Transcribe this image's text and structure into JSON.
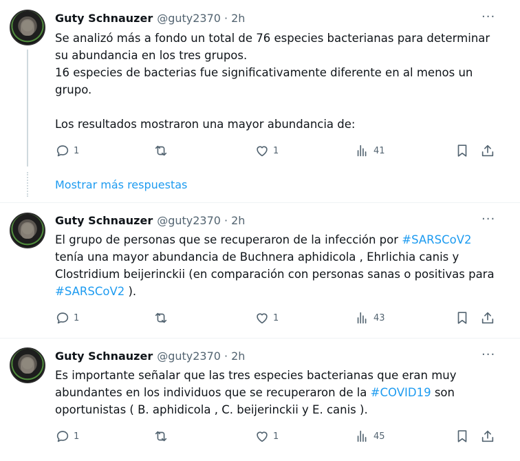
{
  "tweets": [
    {
      "author": "Guty Schnauzer",
      "handle": "@guty2370",
      "separator": "·",
      "time": "2h",
      "more": "···",
      "lines": [
        "Se analizó más a fondo un total de 76 especies bacterianas para determinar",
        "su abundancia en los tres grupos.",
        "16 especies de bacterias fue significativamente diferente en al menos un",
        "grupo.",
        "",
        "Los resultados mostraron una mayor abundancia de:"
      ],
      "replies": "1",
      "retweets": "",
      "likes": "1",
      "views": "41"
    },
    {
      "author": "Guty Schnauzer",
      "handle": "@guty2370",
      "separator": "·",
      "time": "2h",
      "more": "···",
      "line1_a": "El grupo de personas que se recuperaron de la infección por ",
      "line1_hashtag": "#SARSCoV2",
      "line2": "tenía una mayor abundancia de Buchnera aphidicola , Ehrlichia canis y",
      "line3": "Clostridium beijerinckii (en comparación con personas sanas o positivas para",
      "line4_hashtag": "#SARSCoV2",
      "line4_b": " ).",
      "replies": "1",
      "retweets": "",
      "likes": "1",
      "views": "43"
    },
    {
      "author": "Guty Schnauzer",
      "handle": "@guty2370",
      "separator": "·",
      "time": "2h",
      "more": "···",
      "line1": "Es importante señalar que las tres especies bacterianas que eran muy",
      "line2_a": "abundantes en los individuos que se recuperaron de la ",
      "line2_hashtag": "#COVID19",
      "line2_b": " son",
      "line3": "oportunistas ( B. aphidicola , C. beijerinckii y E. canis ).",
      "replies": "1",
      "retweets": "",
      "likes": "1",
      "views": "45"
    }
  ],
  "show_more": "Mostrar más respuestas",
  "icons": [
    "reply-icon",
    "retweet-icon",
    "like-icon",
    "views-icon",
    "bookmark-icon",
    "share-icon"
  ],
  "colors": {
    "link": "#1d9bf0",
    "muted": "#536471",
    "text": "#0f1419"
  }
}
